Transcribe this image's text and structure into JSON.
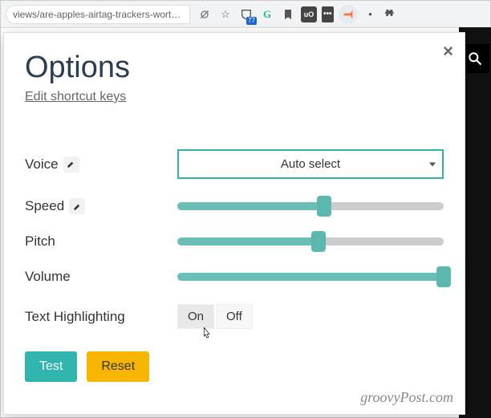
{
  "browser": {
    "url_fragment": "views/are-apples-airtag-trackers-worth-it-that-d...",
    "icons": [
      "no-track-icon",
      "star-icon",
      "pocket-icon",
      "grammarly-icon",
      "bookmark-icon",
      "ublock-icon",
      "cookie-icon",
      "speaker-icon",
      "bullet-icon",
      "puzzle-icon"
    ]
  },
  "site": {
    "search_label": "Search"
  },
  "popup": {
    "title": "Options",
    "edit_link": "Edit shortcut keys",
    "close_label": "×",
    "rows": {
      "voice": {
        "label": "Voice",
        "value": "Auto select"
      },
      "speed": {
        "label": "Speed",
        "value_pct": 55
      },
      "pitch": {
        "label": "Pitch",
        "value_pct": 53
      },
      "volume": {
        "label": "Volume",
        "value_pct": 100
      },
      "highlight": {
        "label": "Text Highlighting",
        "on": "On",
        "off": "Off",
        "value": "On"
      }
    },
    "actions": {
      "test": "Test",
      "reset": "Reset"
    }
  },
  "watermark": "groovyPost.com"
}
